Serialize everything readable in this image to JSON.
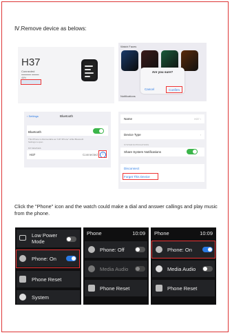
{
  "heading": "Ⅳ.Remove device as belows:",
  "paragraph": "Click the \"Phone\" icon and the watch could make a dial and answer callings and play music from the phone.",
  "device_screen": {
    "name": "H37",
    "status": "Connected",
    "battery": "46%"
  },
  "watch_faces_screen": {
    "header": "Watch Faces",
    "prompt": "Are you sure?",
    "cancel": "Cancel",
    "confirm": "Confirm",
    "section": "Notifications"
  },
  "bluetooth_screen": {
    "back": "Settings",
    "title": "Bluetooth",
    "bluetooth_label": "Bluetooth",
    "desc": "This iPhone is discoverable as \"H37 iPhone\" while Bluetooth Settings is open.",
    "section": "MY DEVICES",
    "device": "H37",
    "device_status": "Connected"
  },
  "settings_screen": {
    "name_label": "Name",
    "name_value": "H37",
    "type_label": "Device Type",
    "section": "SYSTEM NOTIFICATIONS",
    "share_label": "Share System Notifications",
    "disconnect": "Disconnect",
    "forget": "Forget This Device"
  },
  "watch_menu": {
    "low_power": "Low Power Mode",
    "phone_on": "Phone: On",
    "phone_reset": "Phone Reset",
    "system": "System"
  },
  "phone_off_screen": {
    "title": "Phone",
    "time": "10:09",
    "phone": "Phone: Off",
    "media": "Media Audio",
    "reset": "Phone Reset"
  },
  "phone_on_screen": {
    "title": "Phone",
    "time": "10:09",
    "phone": "Phone: On",
    "media": "Media Audio",
    "reset": "Phone Reset"
  },
  "colors": {
    "accent": "#2a7ae4",
    "highlight": "#e33333",
    "toggle_green": "#3bb54a"
  }
}
